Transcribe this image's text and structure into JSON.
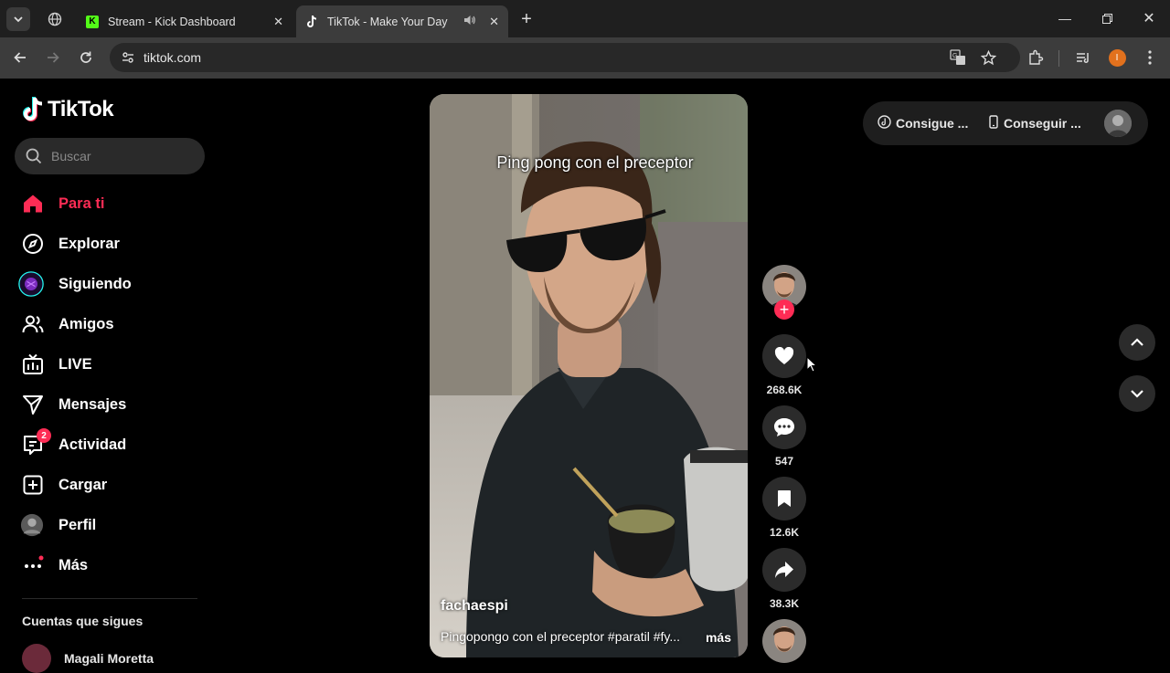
{
  "browser": {
    "tabs": [
      {
        "title": "Stream - Kick Dashboard",
        "icon": "kick-icon"
      },
      {
        "title": "TikTok - Make Your Day",
        "icon": "tiktok-icon",
        "audio": true
      }
    ],
    "url": "tiktok.com",
    "profile_initial": "I"
  },
  "sidebar": {
    "logo_text": "TikTok",
    "search_placeholder": "Buscar",
    "nav": [
      {
        "label": "Para ti",
        "icon": "home-icon",
        "active": true
      },
      {
        "label": "Explorar",
        "icon": "compass-icon"
      },
      {
        "label": "Siguiendo",
        "icon": "following-avatar-icon"
      },
      {
        "label": "Amigos",
        "icon": "friends-icon"
      },
      {
        "label": "LIVE",
        "icon": "live-icon"
      },
      {
        "label": "Mensajes",
        "icon": "messages-icon"
      },
      {
        "label": "Actividad",
        "icon": "activity-icon",
        "badge": "2"
      },
      {
        "label": "Cargar",
        "icon": "upload-icon"
      },
      {
        "label": "Perfil",
        "icon": "profile-avatar-icon"
      },
      {
        "label": "Más",
        "icon": "more-icon"
      }
    ],
    "following_header": "Cuentas que sigues",
    "following_first": "Magali Moretta"
  },
  "video": {
    "overlay_text": "Ping pong con el preceptor",
    "author": "fachaespi",
    "caption": "Pingopongo con el preceptor #paratil #fy...",
    "more_label": "más"
  },
  "actions": {
    "likes": "268.6K",
    "comments": "547",
    "saves": "12.6K",
    "shares": "38.3K"
  },
  "top_right": {
    "item1": "Consigue ...",
    "item2": "Conseguir ..."
  },
  "colors": {
    "accent": "#fe2c55",
    "tab_bar": "#1f1f1f",
    "toolbar": "#3c3c3c"
  }
}
